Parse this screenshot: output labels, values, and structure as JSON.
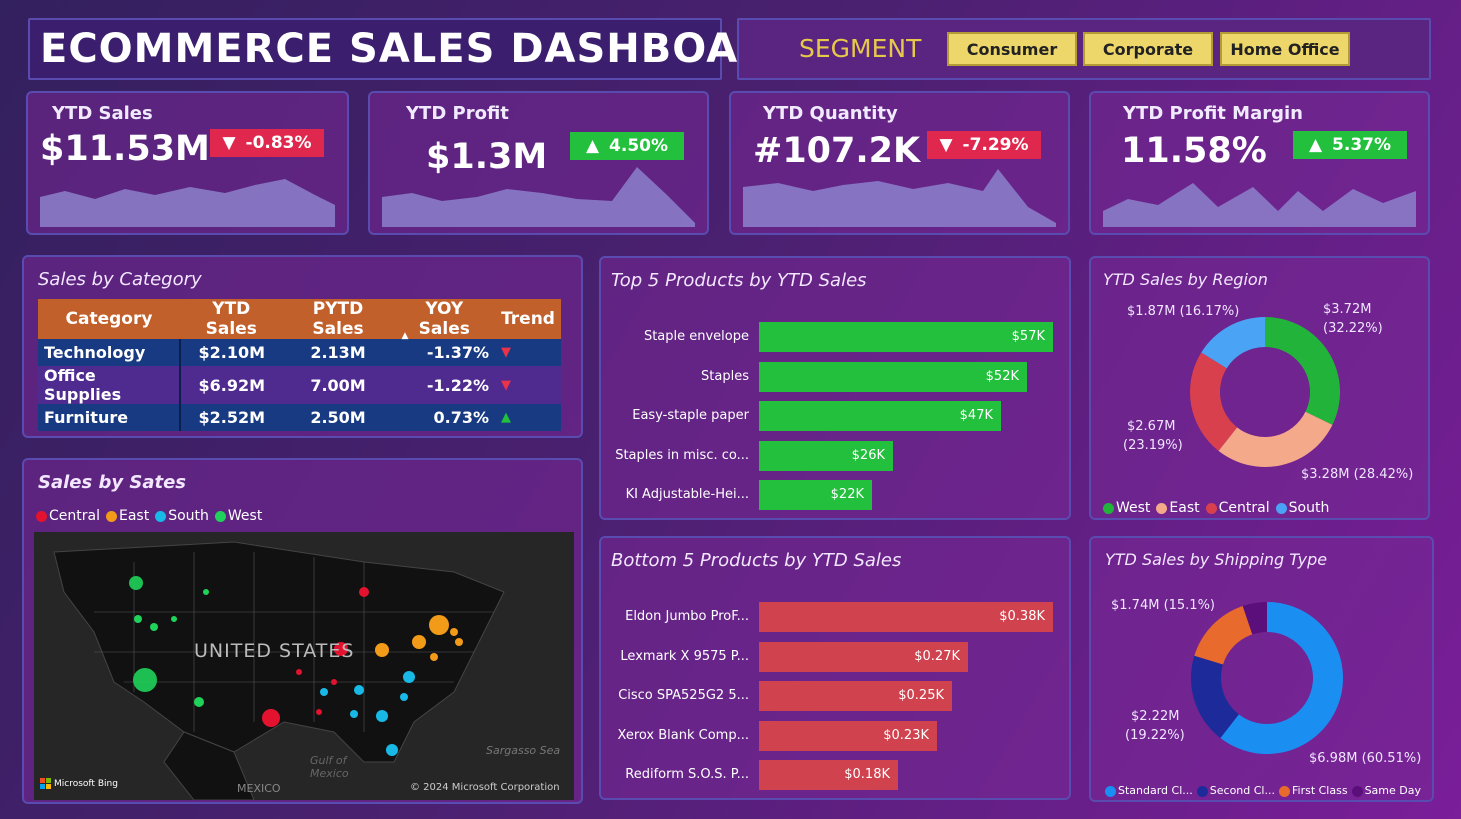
{
  "header": {
    "title": "ECOMMERCE SALES DASHBOARD"
  },
  "segment": {
    "label": "SEGMENT",
    "buttons": [
      "Consumer",
      "Corporate",
      "Home Office"
    ]
  },
  "kpis": [
    {
      "title": "YTD Sales",
      "value": "$11.53M",
      "change": "-0.83%",
      "direction": "down"
    },
    {
      "title": "YTD Profit",
      "value": "$1.3M",
      "change": "4.50%",
      "direction": "up"
    },
    {
      "title": "YTD Quantity",
      "value": "#107.2K",
      "change": "-7.29%",
      "direction": "down"
    },
    {
      "title": "YTD Profit Margin",
      "value": "11.58%",
      "change": "5.37%",
      "direction": "up"
    }
  ],
  "category_table": {
    "title": "Sales by Category",
    "columns": [
      "Category",
      "YTD Sales",
      "PYTD Sales",
      "YOY Sales",
      "Trend"
    ],
    "rows": [
      {
        "category": "Technology",
        "ytd": "$2.10M",
        "pytd": "2.13M",
        "yoy": "-1.37%",
        "trend": "down"
      },
      {
        "category": "Office Supplies",
        "ytd": "$6.92M",
        "pytd": "7.00M",
        "yoy": "-1.22%",
        "trend": "down"
      },
      {
        "category": "Furniture",
        "ytd": "$2.52M",
        "pytd": "2.50M",
        "yoy": "0.73%",
        "trend": "up"
      }
    ]
  },
  "map_panel": {
    "title": "Sales by Sates",
    "legend": [
      {
        "name": "Central",
        "color": "#e3132f"
      },
      {
        "name": "East",
        "color": "#f29b18"
      },
      {
        "name": "South",
        "color": "#18b9e6"
      },
      {
        "name": "West",
        "color": "#1fd35a"
      }
    ],
    "country_label": "UNITED STATES",
    "gulf_label": "Gulf of Mexico",
    "sea_label": "Sargasso Sea",
    "mexico_label": "MEXICO",
    "bing_label": "Microsoft Bing",
    "copyright": "© 2024 Microsoft Corporation"
  },
  "top5": {
    "title": "Top 5 Products by YTD Sales",
    "color": "#22c03c",
    "items": [
      {
        "name": "Staple envelope",
        "label": "$57K",
        "value": 57
      },
      {
        "name": "Staples",
        "label": "$52K",
        "value": 52
      },
      {
        "name": "Easy-staple paper",
        "label": "$47K",
        "value": 47
      },
      {
        "name": "Staples in misc. co...",
        "label": "$26K",
        "value": 26
      },
      {
        "name": "KI Adjustable-Hei...",
        "label": "$22K",
        "value": 22
      }
    ]
  },
  "bottom5": {
    "title": "Bottom 5 Products by YTD Sales",
    "color": "#d0424e",
    "items": [
      {
        "name": "Eldon Jumbo ProF...",
        "label": "$0.38K",
        "value": 0.38
      },
      {
        "name": "Lexmark X 9575 P...",
        "label": "$0.27K",
        "value": 0.27
      },
      {
        "name": "Cisco SPA525G2 5...",
        "label": "$0.25K",
        "value": 0.25
      },
      {
        "name": "Xerox Blank Comp...",
        "label": "$0.23K",
        "value": 0.23
      },
      {
        "name": "Rediform S.O.S. P...",
        "label": "$0.18K",
        "value": 0.18
      }
    ]
  },
  "region": {
    "title": "YTD Sales by Region",
    "slices": [
      {
        "name": "West",
        "value": 32.22,
        "color": "#22b43a",
        "label": "$3.72M",
        "label2": "(32.22%)"
      },
      {
        "name": "East",
        "value": 28.42,
        "color": "#f4a98a",
        "label": "$3.28M (28.42%)",
        "label2": ""
      },
      {
        "name": "Central",
        "value": 23.19,
        "color": "#d8404e",
        "label": "$2.67M",
        "label2": "(23.19%)"
      },
      {
        "name": "South",
        "value": 16.17,
        "color": "#4aa3f5",
        "label": "$1.87M (16.17%)",
        "label2": ""
      }
    ]
  },
  "shipping": {
    "title": "YTD Sales by Shipping Type",
    "slices": [
      {
        "name": "Standard Cl...",
        "value": 60.51,
        "color": "#1b8ef2",
        "label": "$6.98M (60.51%)",
        "label2": ""
      },
      {
        "name": "Second Cl...",
        "value": 19.22,
        "color": "#1c2a9a",
        "label": "$2.22M",
        "label2": "(19.22%)"
      },
      {
        "name": "First Class",
        "value": 15.1,
        "color": "#e86a2c",
        "label": "$1.74M (15.1%)",
        "label2": ""
      },
      {
        "name": "Same Day",
        "value": 5.17,
        "color": "#5b0f7a",
        "label": "",
        "label2": ""
      }
    ]
  }
}
